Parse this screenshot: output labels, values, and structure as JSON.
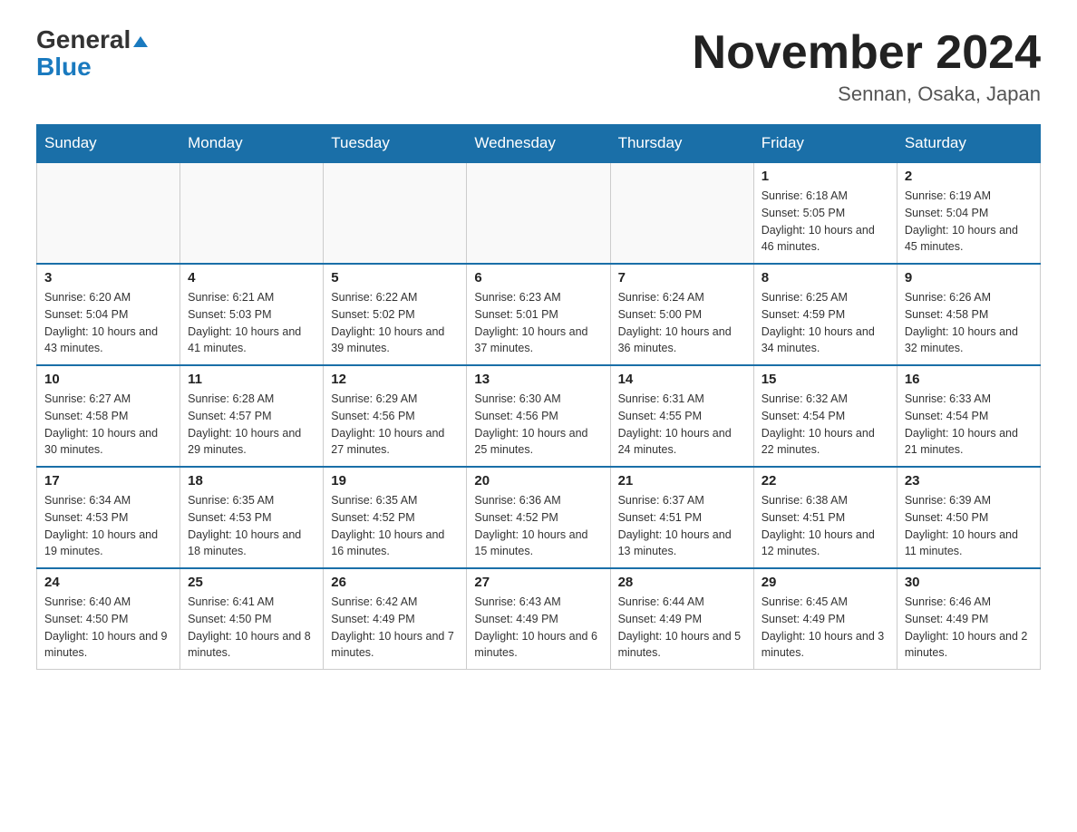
{
  "header": {
    "logo_line1": "General",
    "logo_line2": "Blue",
    "month_title": "November 2024",
    "location": "Sennan, Osaka, Japan"
  },
  "days_of_week": [
    "Sunday",
    "Monday",
    "Tuesday",
    "Wednesday",
    "Thursday",
    "Friday",
    "Saturday"
  ],
  "weeks": [
    [
      {
        "day": "",
        "info": ""
      },
      {
        "day": "",
        "info": ""
      },
      {
        "day": "",
        "info": ""
      },
      {
        "day": "",
        "info": ""
      },
      {
        "day": "",
        "info": ""
      },
      {
        "day": "1",
        "info": "Sunrise: 6:18 AM\nSunset: 5:05 PM\nDaylight: 10 hours and 46 minutes."
      },
      {
        "day": "2",
        "info": "Sunrise: 6:19 AM\nSunset: 5:04 PM\nDaylight: 10 hours and 45 minutes."
      }
    ],
    [
      {
        "day": "3",
        "info": "Sunrise: 6:20 AM\nSunset: 5:04 PM\nDaylight: 10 hours and 43 minutes."
      },
      {
        "day": "4",
        "info": "Sunrise: 6:21 AM\nSunset: 5:03 PM\nDaylight: 10 hours and 41 minutes."
      },
      {
        "day": "5",
        "info": "Sunrise: 6:22 AM\nSunset: 5:02 PM\nDaylight: 10 hours and 39 minutes."
      },
      {
        "day": "6",
        "info": "Sunrise: 6:23 AM\nSunset: 5:01 PM\nDaylight: 10 hours and 37 minutes."
      },
      {
        "day": "7",
        "info": "Sunrise: 6:24 AM\nSunset: 5:00 PM\nDaylight: 10 hours and 36 minutes."
      },
      {
        "day": "8",
        "info": "Sunrise: 6:25 AM\nSunset: 4:59 PM\nDaylight: 10 hours and 34 minutes."
      },
      {
        "day": "9",
        "info": "Sunrise: 6:26 AM\nSunset: 4:58 PM\nDaylight: 10 hours and 32 minutes."
      }
    ],
    [
      {
        "day": "10",
        "info": "Sunrise: 6:27 AM\nSunset: 4:58 PM\nDaylight: 10 hours and 30 minutes."
      },
      {
        "day": "11",
        "info": "Sunrise: 6:28 AM\nSunset: 4:57 PM\nDaylight: 10 hours and 29 minutes."
      },
      {
        "day": "12",
        "info": "Sunrise: 6:29 AM\nSunset: 4:56 PM\nDaylight: 10 hours and 27 minutes."
      },
      {
        "day": "13",
        "info": "Sunrise: 6:30 AM\nSunset: 4:56 PM\nDaylight: 10 hours and 25 minutes."
      },
      {
        "day": "14",
        "info": "Sunrise: 6:31 AM\nSunset: 4:55 PM\nDaylight: 10 hours and 24 minutes."
      },
      {
        "day": "15",
        "info": "Sunrise: 6:32 AM\nSunset: 4:54 PM\nDaylight: 10 hours and 22 minutes."
      },
      {
        "day": "16",
        "info": "Sunrise: 6:33 AM\nSunset: 4:54 PM\nDaylight: 10 hours and 21 minutes."
      }
    ],
    [
      {
        "day": "17",
        "info": "Sunrise: 6:34 AM\nSunset: 4:53 PM\nDaylight: 10 hours and 19 minutes."
      },
      {
        "day": "18",
        "info": "Sunrise: 6:35 AM\nSunset: 4:53 PM\nDaylight: 10 hours and 18 minutes."
      },
      {
        "day": "19",
        "info": "Sunrise: 6:35 AM\nSunset: 4:52 PM\nDaylight: 10 hours and 16 minutes."
      },
      {
        "day": "20",
        "info": "Sunrise: 6:36 AM\nSunset: 4:52 PM\nDaylight: 10 hours and 15 minutes."
      },
      {
        "day": "21",
        "info": "Sunrise: 6:37 AM\nSunset: 4:51 PM\nDaylight: 10 hours and 13 minutes."
      },
      {
        "day": "22",
        "info": "Sunrise: 6:38 AM\nSunset: 4:51 PM\nDaylight: 10 hours and 12 minutes."
      },
      {
        "day": "23",
        "info": "Sunrise: 6:39 AM\nSunset: 4:50 PM\nDaylight: 10 hours and 11 minutes."
      }
    ],
    [
      {
        "day": "24",
        "info": "Sunrise: 6:40 AM\nSunset: 4:50 PM\nDaylight: 10 hours and 9 minutes."
      },
      {
        "day": "25",
        "info": "Sunrise: 6:41 AM\nSunset: 4:50 PM\nDaylight: 10 hours and 8 minutes."
      },
      {
        "day": "26",
        "info": "Sunrise: 6:42 AM\nSunset: 4:49 PM\nDaylight: 10 hours and 7 minutes."
      },
      {
        "day": "27",
        "info": "Sunrise: 6:43 AM\nSunset: 4:49 PM\nDaylight: 10 hours and 6 minutes."
      },
      {
        "day": "28",
        "info": "Sunrise: 6:44 AM\nSunset: 4:49 PM\nDaylight: 10 hours and 5 minutes."
      },
      {
        "day": "29",
        "info": "Sunrise: 6:45 AM\nSunset: 4:49 PM\nDaylight: 10 hours and 3 minutes."
      },
      {
        "day": "30",
        "info": "Sunrise: 6:46 AM\nSunset: 4:49 PM\nDaylight: 10 hours and 2 minutes."
      }
    ]
  ]
}
